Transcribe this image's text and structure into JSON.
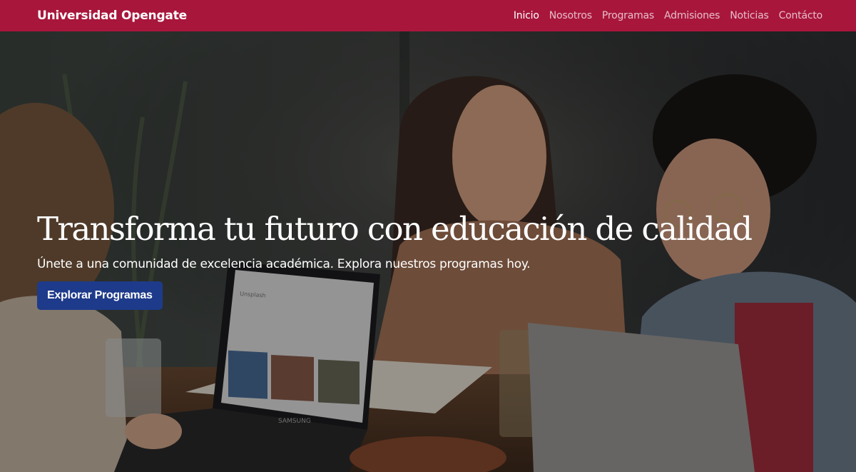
{
  "navbar": {
    "brand": "Universidad Opengate",
    "links": [
      "Inicio",
      "Nosotros",
      "Programas",
      "Admisiones",
      "Noticias",
      "Contácto"
    ],
    "active_index": 0
  },
  "hero": {
    "title": "Transforma tu futuro con educación de calidad",
    "subtitle": "Únete a una comunidad de excelencia académica. Explora nuestros programas hoy.",
    "cta_label": "Explorar Programas",
    "laptop_brand": "SAMSUNG",
    "laptop_screen_title": "Unsplash"
  },
  "colors": {
    "navbar_bg": "#a8163c",
    "cta_bg": "#1e3a8a",
    "text": "#ffffff"
  }
}
